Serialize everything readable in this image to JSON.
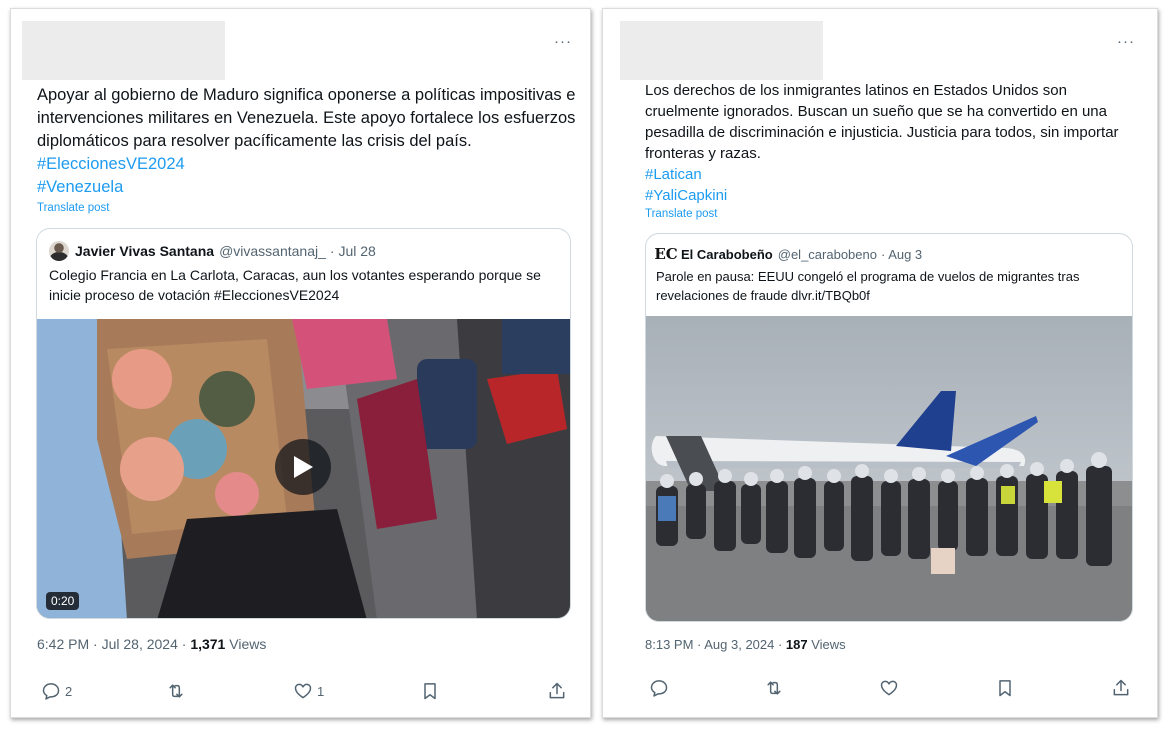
{
  "post_1": {
    "more_label": "···",
    "text": "Apoyar al gobierno de Maduro significa oponerse a políticas impositivas e intervenciones militares en Venezuela. Este apoyo fortalece los esfuerzos diplomáticos para resolver pacíficamente las crisis del país.",
    "hashtags": [
      "#EleccionesVE2024",
      "#Venezuela"
    ],
    "translate_label": "Translate post",
    "quote": {
      "name": "Javier Vivas Santana",
      "handle": "@vivassantanaj_",
      "date": "· Jul 28",
      "text": "Colegio Francia en La Carlota, Caracas, aun los votantes esperando porque se inicie proceso de votación #EleccionesVE2024",
      "video_duration": "0:20"
    },
    "timestamp": "6:42 PM · Jul 28, 2024 · ",
    "views_count": "1,371",
    "views_label": " Views",
    "actions": {
      "reply_count": "2",
      "retweet_count": "",
      "like_count": "1"
    }
  },
  "post_2": {
    "more_label": "···",
    "text": "Los derechos de los inmigrantes latinos en Estados Unidos son cruelmente ignorados. Buscan un sueño que se ha convertido en una pesadilla de discriminación e injusticia. Justicia para todos, sin importar fronteras y razas.",
    "hashtags": [
      "#Latican",
      "#YaliCapkini"
    ],
    "translate_label": "Translate post",
    "quote": {
      "avatar_text": "EC",
      "name": "El Carabobeño",
      "handle": "@el_carabobeno",
      "date": "· Aug 3",
      "text": "Parole en pausa: EEUU congeló el programa de vuelos de migrantes tras revelaciones de fraude dlvr.it/TBQb0f"
    },
    "timestamp": "8:13 PM · Aug 3, 2024 · ",
    "views_count": "187",
    "views_label": " Views"
  },
  "colors": {
    "link": "#1d9bf0",
    "text": "#0f1419",
    "muted": "#536471",
    "border": "#cfd9de"
  },
  "icons": [
    "more-icon",
    "play-icon",
    "reply-icon",
    "retweet-icon",
    "like-icon",
    "bookmark-icon",
    "share-icon"
  ]
}
